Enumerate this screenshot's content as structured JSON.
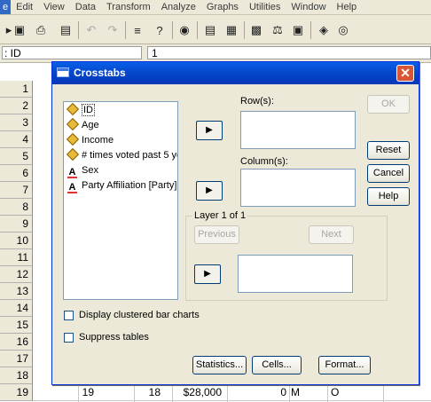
{
  "menubar": {
    "items": [
      {
        "label": "e",
        "selected": true
      },
      {
        "label": "Edit"
      },
      {
        "label": "View"
      },
      {
        "label": "Data"
      },
      {
        "label": "Transform"
      },
      {
        "label": "Analyze"
      },
      {
        "label": "Graphs"
      },
      {
        "label": "Utilities"
      },
      {
        "label": "Window"
      },
      {
        "label": "Help"
      }
    ]
  },
  "toolbar": {
    "icons": [
      "open-icon",
      "save-icon",
      "print-icon",
      "dialog-recall-icon",
      "undo-icon",
      "redo-icon",
      "goto-case-icon",
      "variables-icon",
      "find-icon",
      "insert-cases-icon",
      "insert-variable-icon",
      "split-file-icon",
      "weight-cases-icon",
      "select-cases-icon",
      "value-labels-icon",
      "use-sets-icon"
    ]
  },
  "cellbar": {
    "cell_name": ": ID",
    "cell_value": "1"
  },
  "grid": {
    "row_numbers": [
      "1",
      "2",
      "3",
      "4",
      "5",
      "6",
      "7",
      "8",
      "9",
      "10",
      "11",
      "12",
      "13",
      "14",
      "15",
      "16",
      "17",
      "18",
      "19"
    ],
    "last_row": {
      "c1": "19",
      "c2": "18",
      "c3": "$28,000",
      "c4": "0",
      "c5": "M",
      "c6": "O"
    }
  },
  "dialog": {
    "title": "Crosstabs",
    "variables": [
      {
        "label": "ID",
        "type": "scale",
        "selected": true
      },
      {
        "label": "Age",
        "type": "scale"
      },
      {
        "label": "Income",
        "type": "scale"
      },
      {
        "label": "# times voted past 5 ye",
        "type": "scale"
      },
      {
        "label": "Sex",
        "type": "nominal"
      },
      {
        "label": "Party Affiliation [Party]",
        "type": "nominal"
      }
    ],
    "rows_label": "Row(s):",
    "columns_label": "Column(s):",
    "layer_label": "Layer 1 of 1",
    "previous_label": "Previous",
    "next_label": "Next",
    "ok_label": "OK",
    "reset_label": "Reset",
    "cancel_label": "Cancel",
    "help_label": "Help",
    "clustered_bar_label": "Display clustered bar charts",
    "suppress_tables_label": "Suppress tables",
    "statistics_label": "Statistics...",
    "cells_label": "Cells...",
    "format_label": "Format..."
  }
}
